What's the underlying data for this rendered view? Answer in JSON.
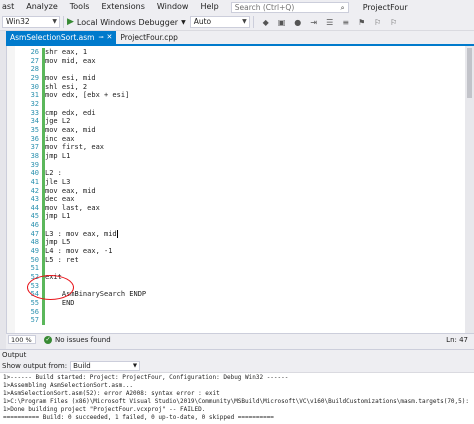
{
  "menubar": {
    "items": [
      "ast",
      "Analyze",
      "Tools",
      "Extensions",
      "Window",
      "Help"
    ],
    "search_placeholder": "Search (Ctrl+Q)",
    "project_title": "ProjectFour"
  },
  "toolbar": {
    "platform": "Win32",
    "debugger_label": "Local Windows Debugger",
    "config": "Auto"
  },
  "tabs": [
    {
      "label": "AsmSelectionSort.asm",
      "active": true
    },
    {
      "label": "ProjectFour.cpp",
      "active": false
    }
  ],
  "editor": {
    "lines": [
      {
        "num": "26",
        "code": "shr eax, 1"
      },
      {
        "num": "27",
        "code": "mov mid, eax"
      },
      {
        "num": "28",
        "code": ""
      },
      {
        "num": "29",
        "code": "mov esi, mid"
      },
      {
        "num": "30",
        "code": "shl esi, 2"
      },
      {
        "num": "31",
        "code": "mov edx, [ebx + esi]"
      },
      {
        "num": "32",
        "code": ""
      },
      {
        "num": "33",
        "code": "cmp edx, edi"
      },
      {
        "num": "34",
        "code": "jge L2"
      },
      {
        "num": "35",
        "code": "mov eax, mid"
      },
      {
        "num": "36",
        "code": "inc eax"
      },
      {
        "num": "37",
        "code": "mov first, eax"
      },
      {
        "num": "38",
        "code": "jmp L1"
      },
      {
        "num": "39",
        "code": ""
      },
      {
        "num": "40",
        "code": "L2 :"
      },
      {
        "num": "41",
        "code": "jle L3"
      },
      {
        "num": "42",
        "code": "mov eax, mid"
      },
      {
        "num": "43",
        "code": "dec eax"
      },
      {
        "num": "44",
        "code": "mov last, eax"
      },
      {
        "num": "45",
        "code": "jmp L1"
      },
      {
        "num": "46",
        "code": ""
      },
      {
        "num": "47",
        "code": "L3 : mov eax, mid"
      },
      {
        "num": "48",
        "code": "jmp L5"
      },
      {
        "num": "49",
        "code": "L4 : mov eax, -1"
      },
      {
        "num": "50",
        "code": "L5 : ret"
      },
      {
        "num": "51",
        "code": ""
      },
      {
        "num": "52",
        "code": "exit"
      },
      {
        "num": "53",
        "code": ""
      },
      {
        "num": "54",
        "code": "    AsmBinarySearch ENDP"
      },
      {
        "num": "55",
        "code": "    END"
      },
      {
        "num": "56",
        "code": ""
      },
      {
        "num": "57",
        "code": ""
      }
    ]
  },
  "status": {
    "zoom": "100 %",
    "issues": "No issues found",
    "position": "Ln: 47"
  },
  "output": {
    "title": "Output",
    "show_from_label": "Show output from:",
    "source": "Build",
    "lines": [
      "1>------ Build started: Project: ProjectFour, Configuration: Debug Win32 ------",
      "1>Assembling AsmSelectionSort.asm...",
      "1>AsmSelectionSort.asm(52): error A2008: syntax error : exit",
      "1>C:\\Program Files (x86)\\Microsoft Visual Studio\\2019\\Community\\MSBuild\\Microsoft\\VC\\v160\\BuildCustomizations\\masm.targets(70,5):",
      "1>Done building project \"ProjectFour.vcxproj\" -- FAILED.",
      "========== Build: 0 succeeded, 1 failed, 0 up-to-date, 0 skipped =========="
    ]
  },
  "icons": {
    "play": "play-icon",
    "check": "check-circle-icon"
  }
}
